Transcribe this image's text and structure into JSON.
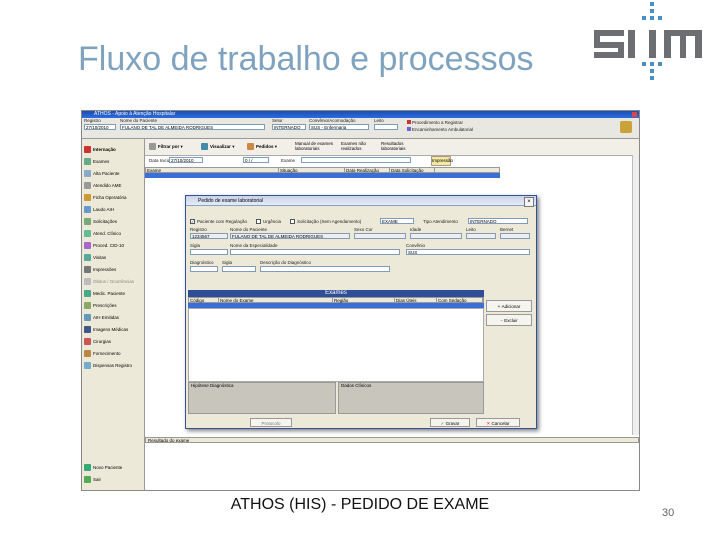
{
  "slide": {
    "title": "Fluxo de trabalho e processos",
    "caption": "ATHOS (HIS) - PEDIDO DE EXAME",
    "page_number": "30"
  },
  "logo": {
    "text": "SIIM"
  },
  "app": {
    "window_title": "ATHOS - Apoio à Atenção Hospitalar",
    "header": {
      "registro_label": "Registro",
      "registro_value": "27/10/2010",
      "nome_label": "Nome do Paciente",
      "nome_value": "FULANO DE TAL DE ALMEIDA RODRIGUES",
      "setor_label": "Setor",
      "setor_value": "INTERNADO",
      "convenio_label": "Convênio/Acomodação",
      "convenio_value": "SUS - Enfermaria",
      "leito_label": "Leito",
      "legend": [
        "Procedimento a Registrar",
        "Encaminhamento Ambulatorial"
      ]
    },
    "sidebar": [
      "Internação",
      "Exames",
      "Alta Paciente",
      "Atendido AME",
      "Ficha Operatória",
      "Laudo AIH",
      "Solicitações",
      "Atend. Clínico",
      "Proced. CID-10",
      "Visitas",
      "Impressões",
      "Óbitos / Ocorrências",
      "Medic. Paciente",
      "Prescrições",
      "AIH Emitidas",
      "Imagens Médicas",
      "Cirurgias",
      "Fornecimento",
      "Dispensas Registro",
      "Novo Paciente",
      "Sair"
    ],
    "toolbar": {
      "btn_filtrar": "Filtrar por",
      "btn_visualizar": "Visualizar",
      "btn_pedidos": "Pedidos",
      "btn_manual": "Manual de exames laboratoriais",
      "btn_exames_realizados": "Exames não realizados",
      "btn_resultados": "Resultados laboratoriais",
      "btn_impressao": "Impressão",
      "data_inicial_label": "Data Inicial",
      "data_inicial": "27/10/2010",
      "data_final": "0 / /",
      "exame_label": "Exame"
    },
    "grid_columns": [
      "Exame",
      "Situação",
      "Data Realização",
      "Data Solicitação"
    ],
    "results_label": "Resultado do exame",
    "dialog": {
      "title": "Pedido de exame laboratorial",
      "chk_paciente": "Paciente com Regulação",
      "chk_urgencia": "Urgência",
      "chk_solicitacao": "Solicitação (Sem Agendamento)",
      "tipo_value": "EXAME",
      "tipo_atendimento_label": "Tipo Atendimento",
      "tipo_atendimento_value": "INTERNADO",
      "registro_label": "Registro",
      "registro_value": "1234567",
      "nome_label": "Nome do Paciente",
      "nome_value": "FULANO DE TAL DE ALMEIDA RODRIGUES",
      "sexo_label": "Sexo Cor",
      "idade_label": "Idade",
      "leito_label": "Leito",
      "berreti_label": "Bernet",
      "sigla_label": "Sigla",
      "especialidade_label": "Nome da Especialidade",
      "convenio_label": "Convênio",
      "convenio_value": "SUS",
      "diagnostico_label": "Diagnóstico",
      "sigla2_label": "Sigla",
      "descricao_label": "Descrição do Diagnóstico",
      "exames_header": "Exames",
      "exames_columns": [
        "Código",
        "Nome do Exame",
        "Região",
        "Dias Úteis",
        "Com Sedação"
      ],
      "btn_adicionar": "Adicionar",
      "btn_excluir": "Excluir",
      "hipotese_label": "Hipótese Diagnóstica",
      "dados_label": "Dados Clínicos",
      "btn_protocolo": "Protocolo",
      "btn_gravar": "Gravar",
      "btn_cancelar": "Cancelar"
    }
  },
  "colors": {
    "title": "#7fa3bf",
    "selection": "#3a6fd8",
    "logo_gray": "#6d6e71",
    "logo_blue": "#4a8fc8"
  }
}
